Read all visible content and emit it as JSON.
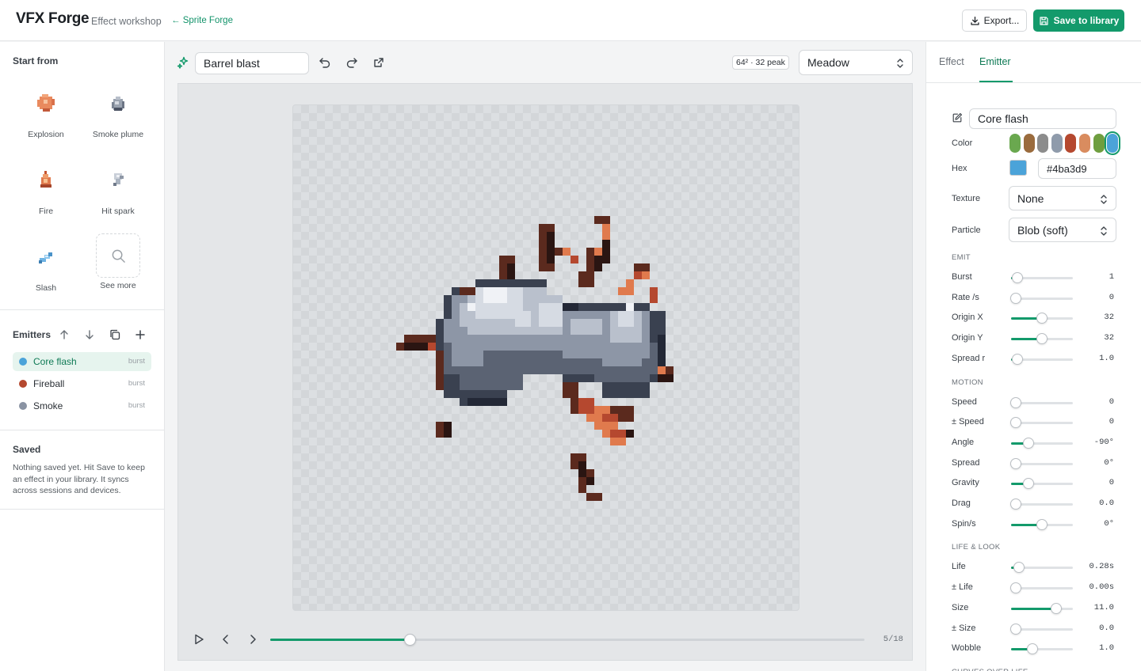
{
  "header": {
    "brand": "VFX Forge",
    "subtitle": "Effect workshop",
    "back_link": "← Sprite Forge",
    "export_label": "Export...",
    "save_label": "Save to library",
    "accent": "#139a6b"
  },
  "sidebar": {
    "start_title": "Start from",
    "presets": [
      {
        "label": "Explosion",
        "icon": "explosion-icon"
      },
      {
        "label": "Smoke plume",
        "icon": "smoke-icon"
      },
      {
        "label": "Fire",
        "icon": "fire-icon"
      },
      {
        "label": "Hit spark",
        "icon": "spark-icon"
      },
      {
        "label": "Slash",
        "icon": "slash-icon"
      },
      {
        "label": "See more",
        "icon": "search-icon"
      }
    ],
    "emitters_title": "Emitters",
    "emitters": [
      {
        "name": "Core flash",
        "kind": "burst",
        "color": "#4ba3d9",
        "active": true
      },
      {
        "name": "Fireball",
        "kind": "burst",
        "color": "#b5482f",
        "active": false
      },
      {
        "name": "Smoke",
        "kind": "burst",
        "color": "#8a93a3",
        "active": false
      }
    ],
    "saved_title": "Saved",
    "saved_text": "Nothing saved yet. Hit Save to keep an effect in your library. It syncs across sessions and devices."
  },
  "editor": {
    "effect_name": "Barrel blast",
    "size_badge": "64² · 32 peak",
    "background_select": "Meadow",
    "frame_label": "5/18",
    "frame_current": 5,
    "frame_total": 18
  },
  "panel": {
    "tabs": [
      {
        "label": "Effect",
        "active": false
      },
      {
        "label": "Emitter",
        "active": true
      }
    ],
    "emitter_name": "Core flash",
    "color_label": "Color",
    "swatches": [
      "#6aa84f",
      "#9a6b3d",
      "#8c8c8c",
      "#8f9bab",
      "#b5482f",
      "#d98c5f",
      "#6f9e3f",
      "#4ba3d9"
    ],
    "selected_swatch": 7,
    "hex_label": "Hex",
    "hex_value": "#4ba3d9",
    "texture_label": "Texture",
    "texture_value": "None",
    "particle_label": "Particle",
    "particle_value": "Blob (soft)",
    "sections": [
      {
        "title": "EMIT",
        "rows": [
          {
            "label": "Burst",
            "value": "1",
            "level": 0.1
          },
          {
            "label": "Rate /s",
            "value": "0",
            "level": 0
          },
          {
            "label": "Origin X",
            "value": "32",
            "level": 0.5
          },
          {
            "label": "Origin Y",
            "value": "32",
            "level": 0.5
          },
          {
            "label": "Spread r",
            "value": "1.0",
            "level": 0.1
          }
        ]
      },
      {
        "title": "MOTION",
        "rows": [
          {
            "label": "Speed",
            "value": "0",
            "level": 0
          },
          {
            "label": "± Speed",
            "value": "0",
            "level": 0
          },
          {
            "label": "Angle",
            "value": "-90°",
            "level": 0.28
          },
          {
            "label": "Spread",
            "value": "0°",
            "level": 0
          },
          {
            "label": "Gravity",
            "value": "0",
            "level": 0.28
          },
          {
            "label": "Drag",
            "value": "0.0",
            "level": 0
          },
          {
            "label": "Spin/s",
            "value": "0°",
            "level": 0.5
          }
        ]
      },
      {
        "title": "LIFE & LOOK",
        "rows": [
          {
            "label": "Life",
            "value": "0.28s",
            "level": 0.13
          },
          {
            "label": "± Life",
            "value": "0.00s",
            "level": 0
          },
          {
            "label": "Size",
            "value": "11.0",
            "level": 0.73
          },
          {
            "label": "± Size",
            "value": "0.0",
            "level": 0
          },
          {
            "label": "Wobble",
            "value": "1.0",
            "level": 0.35
          }
        ]
      },
      {
        "title": "CURVES OVER LIFE",
        "rows": []
      }
    ]
  }
}
